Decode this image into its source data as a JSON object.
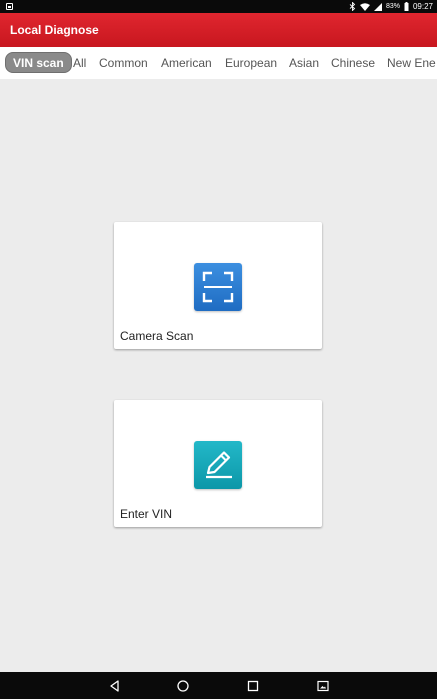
{
  "status_bar": {
    "notification_icon": "image-icon",
    "bluetooth_icon": "bluetooth-icon",
    "wifi_icon": "wifi-icon",
    "signal_icon": "signal-icon",
    "battery": "83%",
    "time": "09:27"
  },
  "header": {
    "title": "Local Diagnose",
    "color": "#d21f27"
  },
  "tabs": [
    {
      "label": "VIN scan",
      "active": true
    },
    {
      "label": "All"
    },
    {
      "label": "Common"
    },
    {
      "label": "American"
    },
    {
      "label": "European"
    },
    {
      "label": "Asian"
    },
    {
      "label": "Chinese"
    },
    {
      "label": "New Ene"
    }
  ],
  "cards": {
    "camera_scan": {
      "label": "Camera Scan",
      "icon": "scan-frame-icon",
      "color": "#2f7fd6"
    },
    "enter_vin": {
      "label": "Enter VIN",
      "icon": "pencil-edit-icon",
      "color": "#17a9ba"
    }
  },
  "nav_bar": {
    "back_icon": "back-icon",
    "home_icon": "home-icon",
    "recents_icon": "recents-icon",
    "screenshot_icon": "screenshot-icon"
  }
}
